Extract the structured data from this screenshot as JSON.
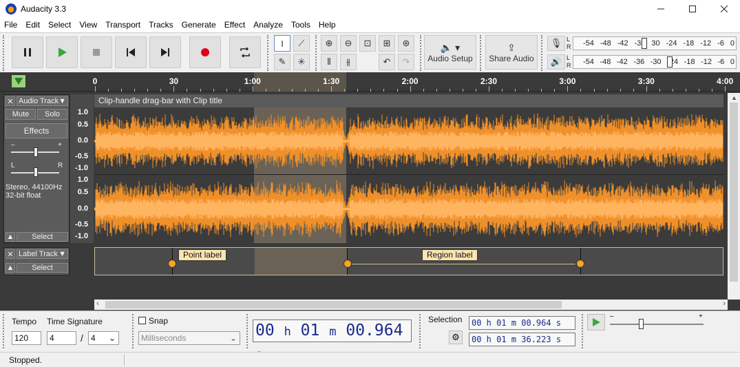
{
  "window": {
    "title": "Audacity 3.3"
  },
  "menu": [
    "File",
    "Edit",
    "Select",
    "View",
    "Transport",
    "Tracks",
    "Generate",
    "Effect",
    "Analyze",
    "Tools",
    "Help"
  ],
  "toolbar": {
    "audio_setup": "Audio Setup",
    "share_audio": "Share Audio"
  },
  "meters": {
    "scale": [
      "-54",
      "-48",
      "-42",
      "-36",
      "-30",
      "-24",
      "-18",
      "-12",
      "-6",
      "0"
    ],
    "record_scale": [
      "-54",
      "-48",
      "-42",
      "-36",
      "30",
      "-24",
      "-18",
      "-12",
      "-6",
      "0"
    ],
    "l": "L",
    "r": "R"
  },
  "timeline": {
    "ticks": [
      "0",
      "30",
      "1:00",
      "1:30",
      "2:00",
      "2:30",
      "3:00",
      "3:30",
      "4:00"
    ]
  },
  "audio_track": {
    "name": "Audio Track",
    "mute": "Mute",
    "solo": "Solo",
    "effects": "Effects",
    "gain_minus": "–",
    "gain_plus": "+",
    "pan_l": "L",
    "pan_r": "R",
    "info_rate": "Stereo, 44100Hz",
    "info_format": "32-bit float",
    "select": "Select",
    "clip_title": "Clip-handle drag-bar with Clip title",
    "ruler": [
      "1.0",
      "0.5",
      "0.0",
      "-0.5",
      "-1.0"
    ]
  },
  "label_track": {
    "name": "Label Track",
    "select": "Select",
    "point_label": "Point label",
    "region_label": "Region label"
  },
  "bottom": {
    "tempo_label": "Tempo",
    "time_sig_label": "Time Signature",
    "tempo": "120",
    "ts_num": "4",
    "ts_sep": "/",
    "ts_den": "4",
    "snap_label": "Snap",
    "snap_units": "Milliseconds",
    "time": {
      "h": "00",
      "m": "01",
      "s": "00.964",
      "hl": "h",
      "ml": "m",
      "sl": "s"
    },
    "selection_label": "Selection",
    "sel_start": "00 h 01 m 00.964 s",
    "sel_end": "00 h 01 m 36.223 s",
    "play_minus": "–",
    "play_plus": "+"
  },
  "status": "Stopped."
}
